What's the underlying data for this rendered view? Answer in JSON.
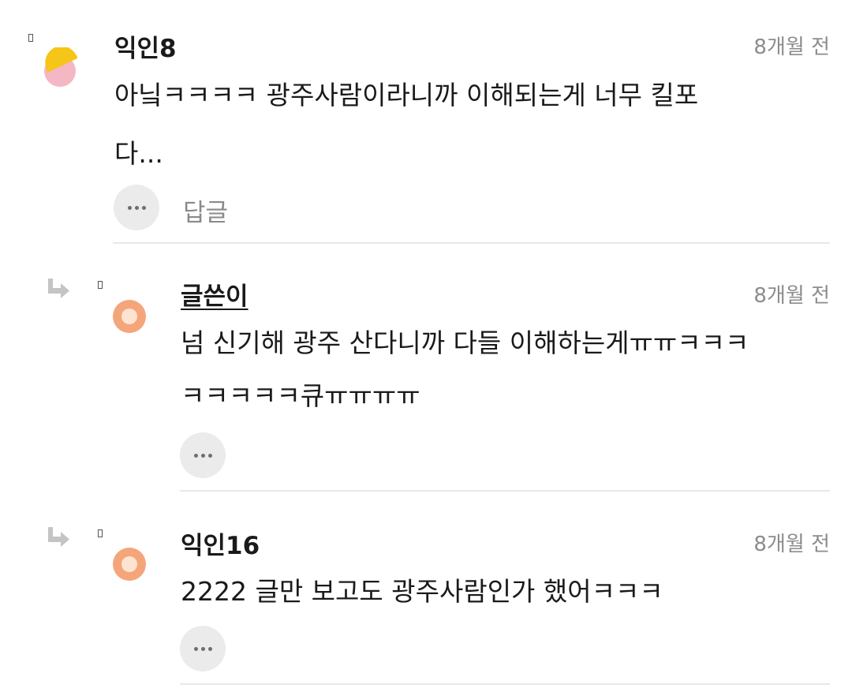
{
  "comments": [
    {
      "author": "익인8",
      "time": "8개월 전",
      "lines": [
        "아닠ㅋㅋㅋㅋ 광주사람이라니까 이해되는게 너무 킬포",
        "다..."
      ],
      "reply_label": "답글",
      "avatar_icon": "yellow-pink-circle-avatar-icon"
    },
    {
      "author": "글쓴이",
      "time": "8개월 전",
      "lines": [
        "넘 신기해 광주 산다니까 다들 이해하는게ㅠㅠㅋㅋㅋ",
        "ㅋㅋㅋㅋㅋ큐ㅠㅠㅠㅠ"
      ],
      "avatar_icon": "orange-circle-avatar-icon",
      "is_reply": true
    },
    {
      "author": "익인16",
      "time": "8개월 전",
      "lines": [
        "2222 글만 보고도 광주사람인가 했어ㅋㅋㅋ"
      ],
      "avatar_icon": "orange-circle-avatar-icon",
      "is_reply": true
    }
  ],
  "colors": {
    "avatar_yellow": "#f5c518",
    "avatar_pink": "#f4b7c4",
    "avatar_orange": "#f5a57a",
    "timestamp": "#8c8c8c",
    "more_button_bg": "#ebebeb",
    "divider": "#e8e8e8"
  }
}
